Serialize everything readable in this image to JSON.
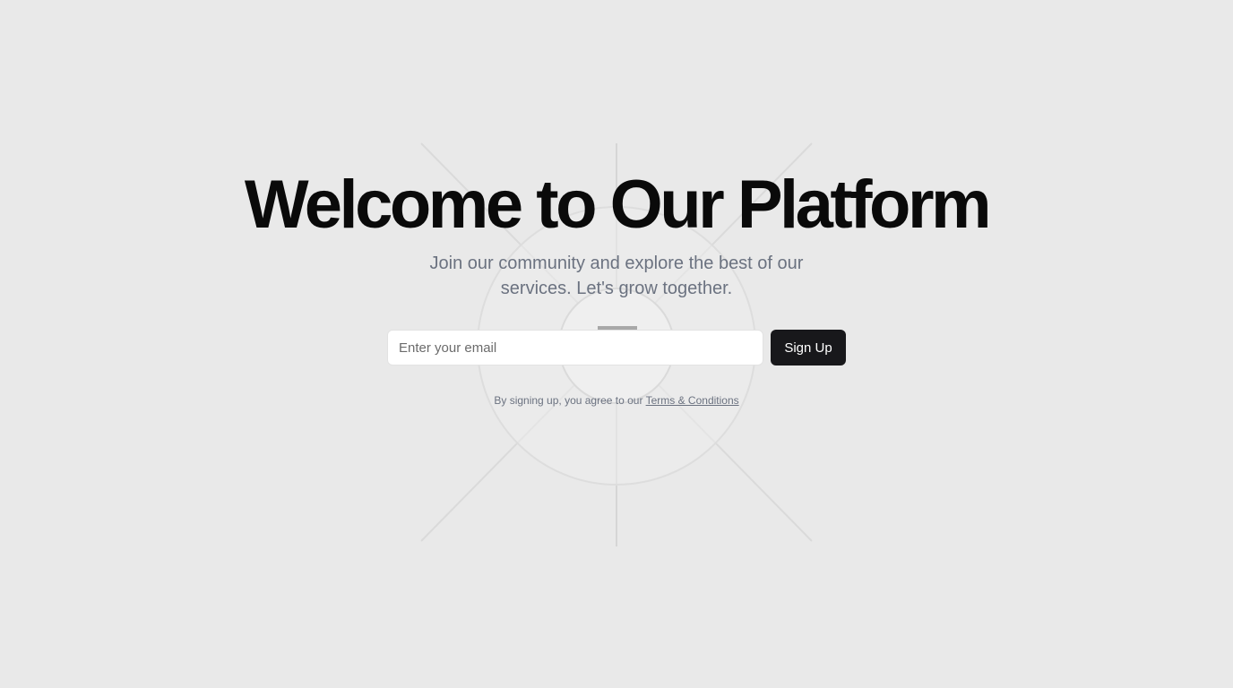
{
  "hero": {
    "title": "Welcome to Our Platform",
    "subtitle": "Join our community and explore the best of our services. Let's grow together."
  },
  "form": {
    "email_placeholder": "Enter your email",
    "email_value": "",
    "submit_label": "Sign Up"
  },
  "legal": {
    "prefix": "By signing up, you agree to our ",
    "link_label": "Terms & Conditions"
  },
  "colors": {
    "background": "#e9e9e9",
    "button_bg": "#18181b",
    "muted_text": "#6b7280"
  }
}
